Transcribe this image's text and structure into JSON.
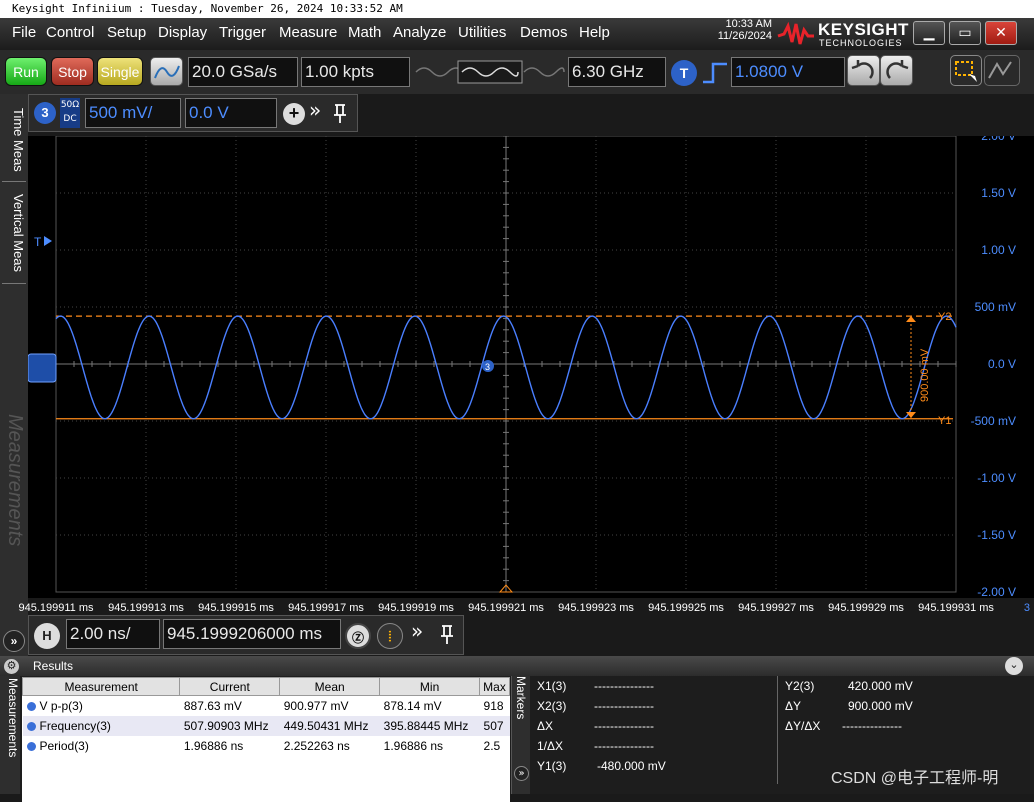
{
  "window": {
    "title": "Keysight Infiniium : Tuesday, November 26, 2024 10:33:52 AM",
    "time": "10:33 AM",
    "date": "11/26/2024",
    "brand": "KEYSIGHT",
    "brand_sub": "TECHNOLOGIES",
    "minimize": "▁",
    "maximize": "▭",
    "close": "✕"
  },
  "menu": [
    "File",
    "Control",
    "Setup",
    "Display",
    "Trigger",
    "Measure",
    "Math",
    "Analyze",
    "Utilities",
    "Demos",
    "Help"
  ],
  "toolbar": {
    "run": "Run",
    "stop": "Stop",
    "single": "Single",
    "sample_rate": "20.0 GSa/s",
    "memory_depth": "1.00 kpts",
    "bandwidth": "6.30 GHz",
    "trigger_badge": "T",
    "trigger_level": "1.0800 V"
  },
  "side_tabs": [
    "Time Meas",
    "Vertical Meas",
    "Measurements"
  ],
  "channel": {
    "number": "3",
    "coupling_top": "50Ω",
    "coupling_bottom": "DC",
    "scale": "500 mV/",
    "offset": "0.0 V"
  },
  "plot": {
    "trigger_marker": "T",
    "channel_marker": "3",
    "y1_label": "Y1",
    "y2_label": "Y2",
    "delta_label": "900.00 mV",
    "y_ticks": [
      {
        "label": "2.00 V",
        "v": 2.0
      },
      {
        "label": "1.50 V",
        "v": 1.5
      },
      {
        "label": "1.00 V",
        "v": 1.0
      },
      {
        "label": "500 mV",
        "v": 0.5
      },
      {
        "label": "0.0 V",
        "v": 0.0
      },
      {
        "label": "-500 mV",
        "v": -0.5
      },
      {
        "label": "-1.00 V",
        "v": -1.0
      },
      {
        "label": "-1.50 V",
        "v": -1.5
      },
      {
        "label": "-2.00 V",
        "v": -2.0
      }
    ],
    "x_ticks": [
      "945.199911 ms",
      "945.199913 ms",
      "945.199915 ms",
      "945.199917 ms",
      "945.199919 ms",
      "945.199921 ms",
      "945.199923 ms",
      "945.199925 ms",
      "945.199927 ms",
      "945.199929 ms",
      "945.199931 ms"
    ],
    "x_tick_suffix": "3"
  },
  "chart_data": {
    "type": "line",
    "title": "",
    "xlabel": "",
    "ylabel": "",
    "x_range_ns": [
      0,
      20
    ],
    "ylim": [
      -2.0,
      2.0
    ],
    "series": [
      {
        "name": "",
        "frequency_mhz": 507.9,
        "vmax": 0.42,
        "vmin": -0.48,
        "color": "#4a7fff"
      }
    ],
    "y1_cursor_v": -0.48,
    "y2_cursor_v": 0.42,
    "cursor_color": "#ff8c1a"
  },
  "timebase": {
    "badge": "H",
    "scale": "2.00 ns/",
    "position": "945.1999206000 ms"
  },
  "results": {
    "title": "Results",
    "columns": [
      "Measurement",
      "Current",
      "Mean",
      "Min",
      "Max"
    ],
    "rows": [
      [
        "V p-p(3)",
        "887.63 mV",
        "900.977 mV",
        "878.14 mV",
        "918"
      ],
      [
        "Frequency(3)",
        "507.90903 MHz",
        "449.50431 MHz",
        "395.88445 MHz",
        "507"
      ],
      [
        "Period(3)",
        "1.96886 ns",
        "2.252263 ns",
        "1.96886 ns",
        "2.5"
      ]
    ],
    "markers_tab": "Markers",
    "markers_dots": "- -",
    "markers_left": [
      {
        "label": "X1(3)",
        "value": "---------------"
      },
      {
        "label": "X2(3)",
        "value": "---------------"
      },
      {
        "label": "ΔX",
        "value": "---------------"
      },
      {
        "label": "1/ΔX",
        "value": "---------------"
      },
      {
        "label": "Y1(3)",
        "value": "-480.000 mV"
      }
    ],
    "markers_right": [
      {
        "label": "Y2(3)",
        "value": "420.000 mV"
      },
      {
        "label": "ΔY",
        "value": "900.000 mV"
      },
      {
        "label": "ΔY/ΔX",
        "value": "---------------"
      }
    ],
    "watermark": "CSDN @电子工程师-明"
  }
}
